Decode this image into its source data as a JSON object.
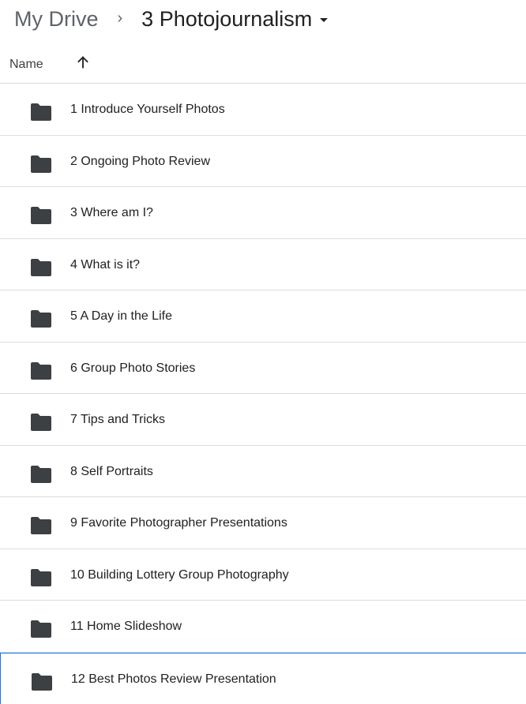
{
  "breadcrumb": {
    "root": "My Drive",
    "separator": "›",
    "current": "3 Photojournalism"
  },
  "header": {
    "name_label": "Name",
    "sort_direction": "ascending"
  },
  "colors": {
    "folder": "#3c4043",
    "divider": "#dadce0",
    "selection": "#1a73e8"
  },
  "items": [
    {
      "label": "1 Introduce Yourself Photos",
      "icon": "folder-icon"
    },
    {
      "label": "2 Ongoing Photo Review",
      "icon": "folder-icon"
    },
    {
      "label": "3 Where am I?",
      "icon": "folder-icon"
    },
    {
      "label": "4 What is it?",
      "icon": "folder-icon"
    },
    {
      "label": "5 A Day in the Life",
      "icon": "folder-icon"
    },
    {
      "label": "6 Group Photo Stories",
      "icon": "folder-icon"
    },
    {
      "label": "7 Tips and Tricks",
      "icon": "folder-icon"
    },
    {
      "label": "8 Self Portraits",
      "icon": "folder-icon"
    },
    {
      "label": "9 Favorite Photographer Presentations",
      "icon": "folder-icon"
    },
    {
      "label": "10 Building Lottery Group Photography",
      "icon": "folder-icon"
    },
    {
      "label": "11 Home Slideshow",
      "icon": "folder-icon"
    },
    {
      "label": "12 Best Photos Review Presentation",
      "icon": "folder-icon",
      "selected": true
    }
  ]
}
